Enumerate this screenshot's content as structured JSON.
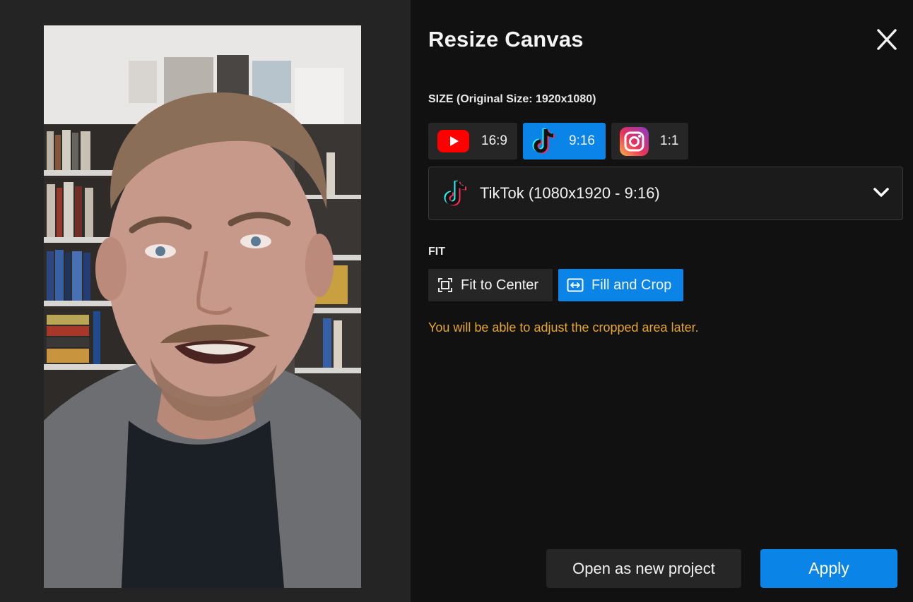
{
  "dialog": {
    "title": "Resize Canvas",
    "close_icon": "close-icon"
  },
  "size": {
    "label": "SIZE (Original Size: 1920x1080)",
    "ratios": [
      {
        "icon": "youtube-icon",
        "label": "16:9",
        "selected": false
      },
      {
        "icon": "tiktok-icon",
        "label": "9:16",
        "selected": true
      },
      {
        "icon": "instagram-icon",
        "label": "1:1",
        "selected": false
      }
    ],
    "preset": {
      "icon": "tiktok-icon",
      "value": "TikTok (1080x1920 - 9:16)"
    }
  },
  "fit": {
    "label": "FIT",
    "options": [
      {
        "icon": "fit-center-icon",
        "label": "Fit to Center",
        "selected": false
      },
      {
        "icon": "fill-crop-icon",
        "label": "Fill and Crop",
        "selected": true
      }
    ],
    "hint": "You will be able to adjust the cropped area later."
  },
  "actions": {
    "open_new_label": "Open as new project",
    "apply_label": "Apply"
  },
  "colors": {
    "accent": "#0a84e6",
    "hint": "#e6a62c",
    "background": "#111111"
  }
}
